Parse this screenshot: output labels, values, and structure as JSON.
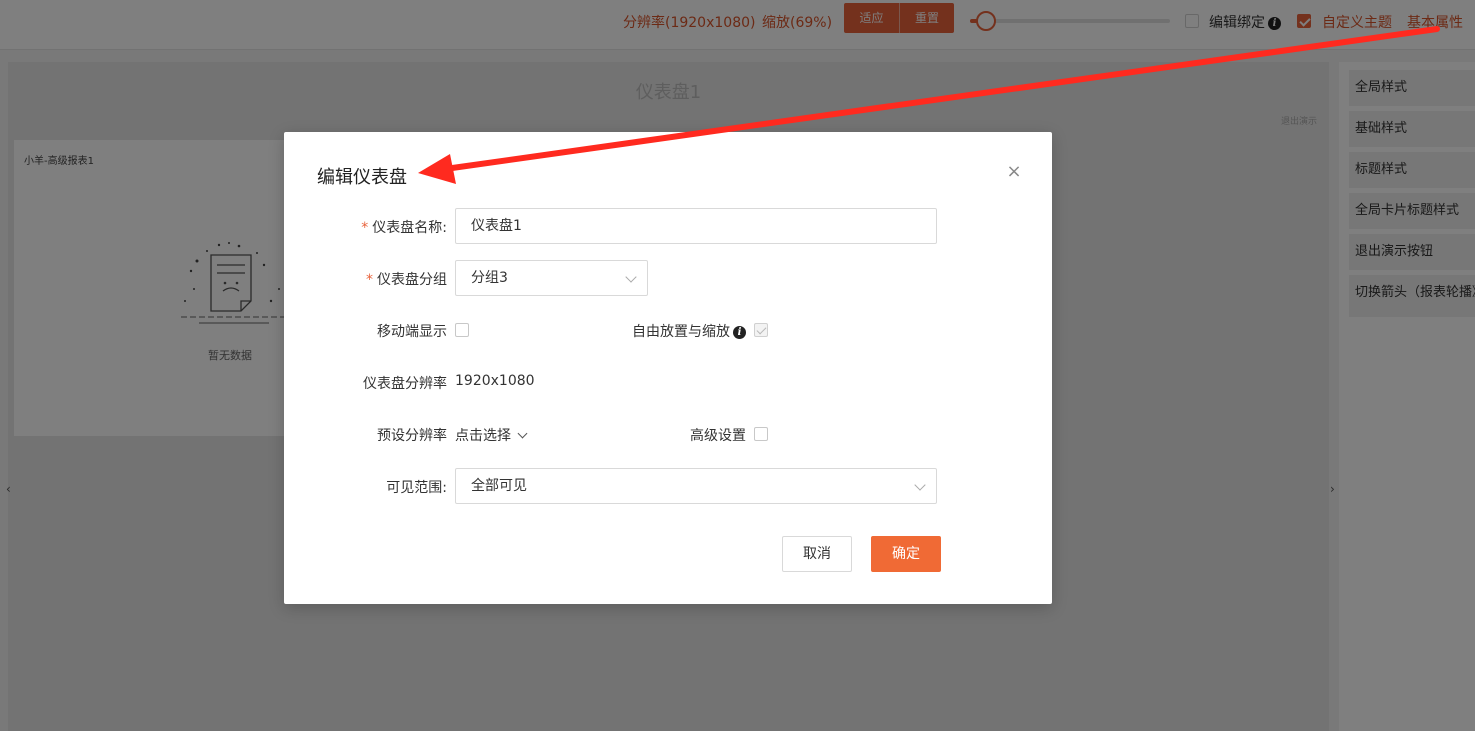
{
  "toolbar": {
    "resolution": "分辨率(1920x1080)",
    "zoom": "缩放(69%)",
    "fit_label": "适应",
    "reset_label": "重置",
    "zoom_slider_value": 0.08,
    "edit_binding_label": "编辑绑定",
    "edit_binding_checked": false,
    "custom_theme_label": "自定义主题",
    "custom_theme_checked": true,
    "basic_props_label": "基本属性"
  },
  "canvas": {
    "title": "仪表盘1",
    "exit_demo": "退出演示",
    "card_title": "小羊-高级报表1",
    "empty_text": "暂无数据"
  },
  "right_panel": {
    "items": [
      "全局样式",
      "基础样式",
      "标题样式",
      "全局卡片标题样式",
      "退出演示按钮",
      "切换箭头（报表轮播》"
    ]
  },
  "modal": {
    "title": "编辑仪表盘",
    "name_label": "仪表盘名称:",
    "name_value": "仪表盘1",
    "group_label": "仪表盘分组",
    "group_value": "分组3",
    "mobile_label": "移动端显示",
    "mobile_checked": false,
    "free_label": "自由放置与缩放",
    "free_checked": true,
    "resolution_label": "仪表盘分辨率",
    "resolution_value": "1920x1080",
    "preset_label": "预设分辨率",
    "preset_value": "点击选择",
    "advanced_label": "高级设置",
    "advanced_checked": false,
    "visibility_label": "可见范围:",
    "visibility_value": "全部可见",
    "cancel_label": "取消",
    "ok_label": "确定"
  },
  "colors": {
    "accent": "#e8623b",
    "annotation_arrow": "#ff2a1f"
  }
}
